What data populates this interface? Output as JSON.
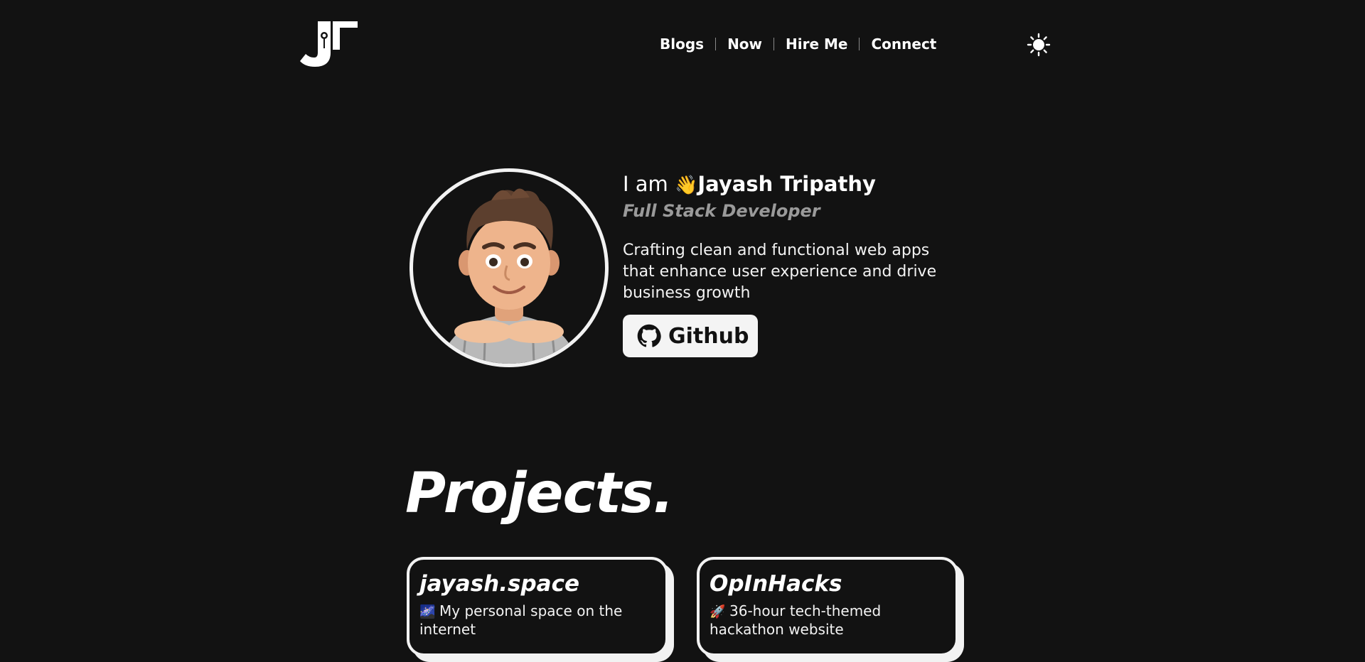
{
  "header": {
    "logo_text": "JT",
    "nav": [
      {
        "label": "Blogs"
      },
      {
        "label": "Now"
      },
      {
        "label": "Hire Me"
      },
      {
        "label": "Connect"
      }
    ],
    "theme_toggle_icon": "sun-icon"
  },
  "hero": {
    "intro_prefix": "I am",
    "wave_emoji": "👋",
    "name": "Jayash Tripathy",
    "role": "Full Stack Developer",
    "tagline": "Crafting clean and functional web apps that enhance user experience and drive business growth",
    "github_label": "Github",
    "avatar_icon": "memoji-avatar"
  },
  "projects": {
    "title": "Projects.",
    "items": [
      {
        "title": "jayash.space",
        "emoji": "🌌",
        "description": "My personal space on the internet"
      },
      {
        "title": "OpInHacks",
        "emoji": "🚀",
        "description": "36-hour tech-themed hackathon website"
      }
    ]
  },
  "colors": {
    "background": "#121212",
    "foreground": "#ffffff",
    "muted": "#9a9a9a",
    "button_bg": "#f4f4f4"
  }
}
